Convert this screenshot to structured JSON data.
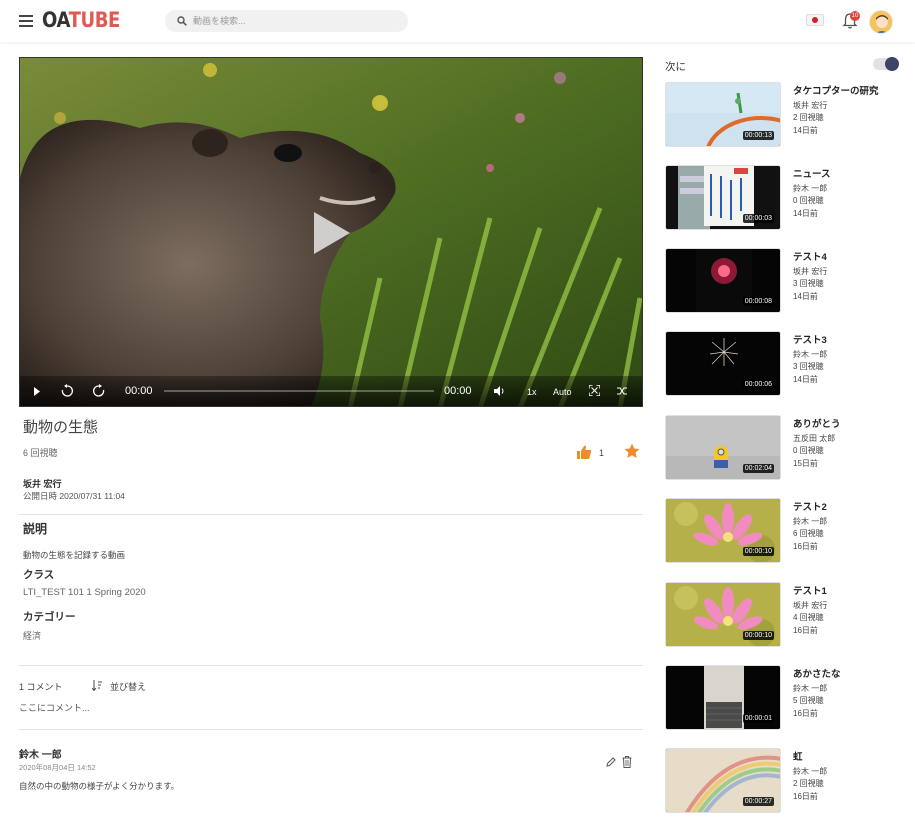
{
  "header": {
    "logo_oa": "OA",
    "logo_tube": "TUBE",
    "search_placeholder": "動画を検索...",
    "notification_count": "10",
    "accent": "#e05a55"
  },
  "player": {
    "current_time": "00:00",
    "total_time": "00:00",
    "speed": "1x",
    "quality": "Auto"
  },
  "video": {
    "title": "動物の生態",
    "views": "6 回視聴",
    "likes": "1",
    "author": "坂井 宏行",
    "published": "公開日時 2020/07/31 11:04",
    "description_heading": "説明",
    "description": "動物の生態を記録する動画",
    "class_label": "クラス",
    "class_value": "LTI_TEST 101 1 Spring 2020",
    "category_label": "カテゴリー",
    "category_value": "経済"
  },
  "comments": {
    "count_label": "1 コメント",
    "sort_label": "並び替え",
    "input_placeholder": "ここにコメント...",
    "items": [
      {
        "author": "鈴木 一郎",
        "date": "2020年08月04日 14:52",
        "text": "自然の中の動物の様子がよく分かります。"
      }
    ]
  },
  "sidebar": {
    "next_label": "次に",
    "items": [
      {
        "title": "タケコプターの研究",
        "author": "坂井 宏行",
        "views": "2 回視聴",
        "age": "14日前",
        "duration": "00:00:13"
      },
      {
        "title": "ニュース",
        "author": "鈴木 一郎",
        "views": "0 回視聴",
        "age": "14日前",
        "duration": "00:00:03"
      },
      {
        "title": "テスト4",
        "author": "坂井 宏行",
        "views": "3 回視聴",
        "age": "14日前",
        "duration": "00:00:08"
      },
      {
        "title": "テスト3",
        "author": "鈴木 一郎",
        "views": "3 回視聴",
        "age": "14日前",
        "duration": "00:00:06"
      },
      {
        "title": "ありがとう",
        "author": "五反田 太郎",
        "views": "0 回視聴",
        "age": "15日前",
        "duration": "00:02:04"
      },
      {
        "title": "テスト2",
        "author": "鈴木 一郎",
        "views": "6 回視聴",
        "age": "16日前",
        "duration": "00:00:10"
      },
      {
        "title": "テスト1",
        "author": "坂井 宏行",
        "views": "4 回視聴",
        "age": "16日前",
        "duration": "00:00:10"
      },
      {
        "title": "あかさたな",
        "author": "鈴木 一郎",
        "views": "5 回視聴",
        "age": "16日前",
        "duration": "00:00:01"
      },
      {
        "title": "虹",
        "author": "鈴木 一郎",
        "views": "2 回視聴",
        "age": "16日前",
        "duration": "00:00:27"
      }
    ]
  }
}
